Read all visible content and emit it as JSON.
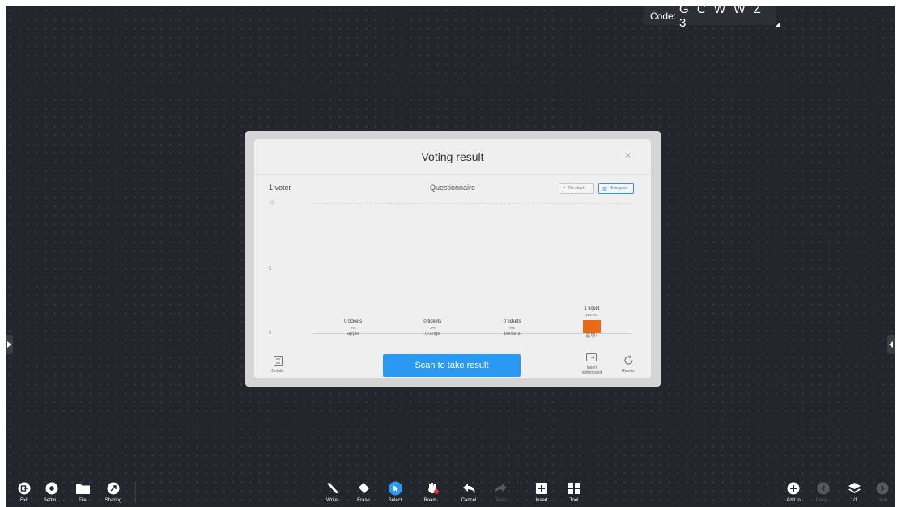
{
  "code": {
    "label": "Code:",
    "value": "G C W W Z 3"
  },
  "dialog": {
    "title": "Voting result",
    "close": "×",
    "voters": "1 voter",
    "questionnaire": "Questionnaire",
    "pie_chart_label": "Pie chart",
    "histogram_label": "Histogram",
    "details_label": "Details",
    "scan_label": "Scan to take result",
    "insert_whiteboard_label": "Insert whiteboard",
    "revote_label": "Revote"
  },
  "chart_data": {
    "type": "bar",
    "categories": [
      "apple",
      "orange",
      "banana",
      "选项4"
    ],
    "values": [
      0,
      0,
      0,
      1
    ],
    "value_labels": [
      "0 tickets",
      "0 tickets",
      "0 tickets",
      "1 ticket"
    ],
    "percent_labels": [
      "0%",
      "0%",
      "0%",
      "100.0%"
    ],
    "yticks": [
      "10",
      "5",
      "0"
    ],
    "ylim": [
      0,
      10
    ],
    "bar_color": "#e86a17"
  },
  "toolbar": {
    "left": [
      {
        "name": "exit",
        "label": "Exit"
      },
      {
        "name": "settings",
        "label": "Settin..."
      },
      {
        "name": "file",
        "label": "File"
      },
      {
        "name": "sharing",
        "label": "Sharing"
      }
    ],
    "center": [
      {
        "name": "write",
        "label": "Write"
      },
      {
        "name": "erase",
        "label": "Erase"
      },
      {
        "name": "select",
        "label": "Select"
      },
      {
        "name": "roam",
        "label": "Roam..."
      },
      {
        "name": "cancel",
        "label": "Cancel"
      },
      {
        "name": "redo",
        "label": "Redo"
      },
      {
        "name": "insert",
        "label": "Insert"
      },
      {
        "name": "tool",
        "label": "Tool"
      }
    ],
    "right": [
      {
        "name": "add-to",
        "label": "Add to"
      },
      {
        "name": "previous",
        "label": "Previ..."
      },
      {
        "name": "pages",
        "label": "1/1"
      },
      {
        "name": "next",
        "label": "Next"
      }
    ]
  },
  "colors": {
    "accent": "#2a9af0",
    "board": "#23272d",
    "bar": "#e86a17"
  }
}
